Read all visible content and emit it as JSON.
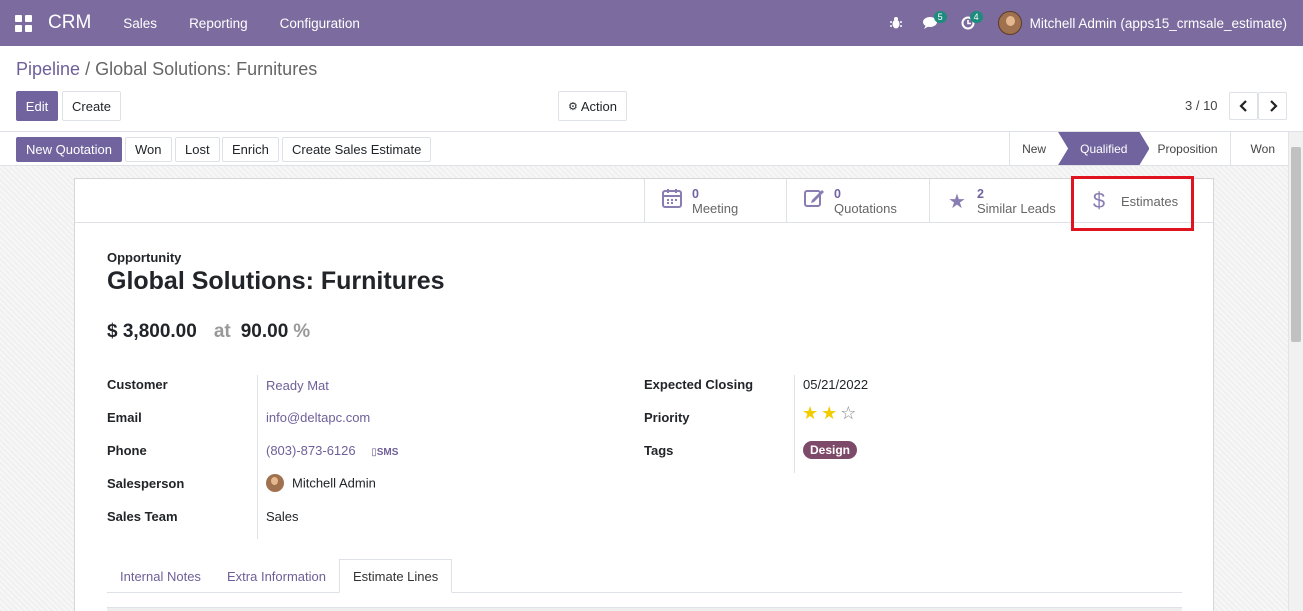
{
  "navbar": {
    "app_name": "CRM",
    "menu": [
      "Sales",
      "Reporting",
      "Configuration"
    ],
    "chat_badge": "5",
    "activity_badge": "4",
    "user": "Mitchell Admin (apps15_crmsale_estimate)"
  },
  "breadcrumb": {
    "parent": "Pipeline",
    "separator": "/",
    "current": "Global Solutions: Furnitures"
  },
  "control": {
    "edit": "Edit",
    "create": "Create",
    "action": "Action",
    "pager": "3 / 10"
  },
  "statusbar": {
    "buttons": [
      "New Quotation",
      "Won",
      "Lost",
      "Enrich",
      "Create Sales Estimate"
    ],
    "stages": [
      "New",
      "Qualified",
      "Proposition",
      "Won"
    ],
    "active_stage": "Qualified"
  },
  "smart_buttons": [
    {
      "icon": "calendar-icon",
      "count": "0",
      "label": "Meeting"
    },
    {
      "icon": "edit-icon",
      "count": "0",
      "label": "Quotations"
    },
    {
      "icon": "star-icon",
      "count": "2",
      "label": "Similar Leads"
    },
    {
      "icon": "dollar-icon",
      "count": "",
      "label": "Estimates"
    }
  ],
  "form": {
    "type_label": "Opportunity",
    "title": "Global Solutions: Furnitures",
    "expected_revenue": "$ 3,800.00",
    "at": "at",
    "probability": "90.00",
    "percent": "%",
    "left_fields": [
      {
        "label": "Customer",
        "value": "Ready Mat"
      },
      {
        "label": "Email",
        "value": "info@deltapc.com"
      },
      {
        "label": "Phone",
        "value": "(803)-873-6126",
        "extra": "SMS"
      },
      {
        "label": "Salesperson",
        "value": "Mitchell Admin"
      },
      {
        "label": "Sales Team",
        "value": "Sales"
      }
    ],
    "right_fields": [
      {
        "label": "Expected Closing",
        "value": "05/21/2022"
      },
      {
        "label": "Priority",
        "stars_filled": 2,
        "stars_total": 3
      },
      {
        "label": "Tags",
        "value": "Design"
      }
    ]
  },
  "tabs": [
    "Internal Notes",
    "Extra Information",
    "Estimate Lines"
  ],
  "active_tab": "Estimate Lines",
  "colors": {
    "navbar": "#7c6b9e",
    "primary": "#71639e",
    "highlight": "#e0141e",
    "tag": "#7e4a69"
  }
}
